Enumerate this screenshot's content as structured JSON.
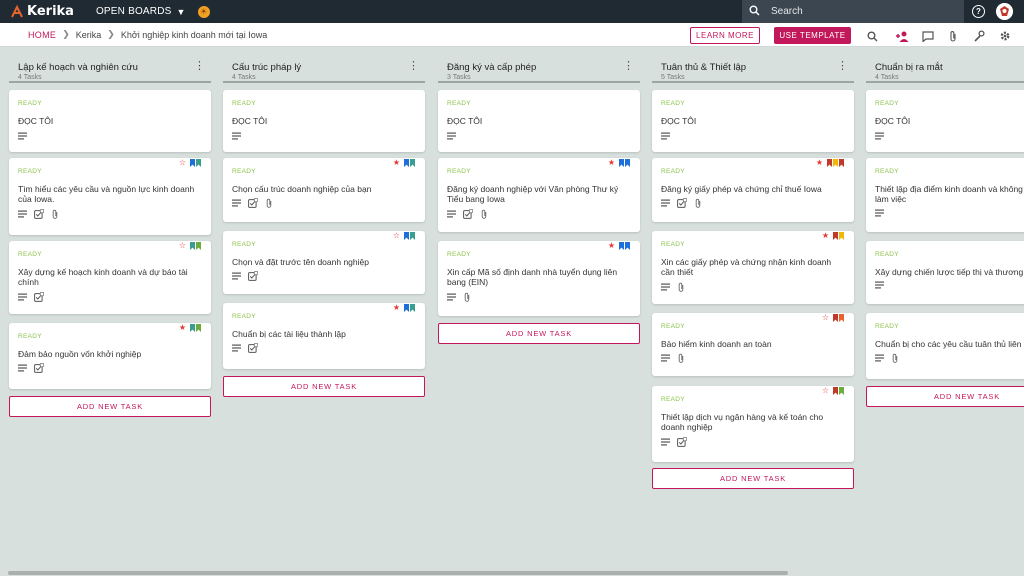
{
  "topbar": {
    "logo": "Kerika",
    "boards_menu": "OPEN BOARDS",
    "search_placeholder": "Search"
  },
  "breadcrumb": {
    "home": "HOME",
    "org": "Kerika",
    "board": "Khởi nghiệp kinh doanh mới tại Iowa"
  },
  "actions": {
    "learn_more": "LEARN MORE",
    "use_template": "USE TEMPLATE"
  },
  "add_task_label": "ADD NEW TASK",
  "colors": {
    "accent": "#c2185b",
    "ready": "#8bc34a",
    "topbar": "#1f2a33",
    "flag_blue": "#1e6fd9",
    "flag_teal": "#3a9e8f",
    "flag_green": "#6cab3c",
    "flag_red": "#c0392b",
    "flag_yellow": "#f2b705",
    "flag_orange": "#e8632b"
  },
  "columns": [
    {
      "title": "Lập kế hoạch và nghiên cứu",
      "count": "4 Tasks",
      "cards": [
        {
          "status": "READY",
          "title": "ĐỌC TÔI",
          "icons": [
            "desc"
          ]
        },
        {
          "status": "READY",
          "title": "Tìm hiểu các yêu cầu và nguồn lực kinh doanh của Iowa.",
          "star": "outline",
          "flags": [
            "flag_blue",
            "flag_teal"
          ],
          "icons": [
            "desc",
            "check",
            "clip"
          ],
          "check_count": "0"
        },
        {
          "status": "READY",
          "title": "Xây dựng kế hoạch kinh doanh và dự báo tài chính",
          "star": "outline",
          "flags": [
            "flag_teal",
            "flag_green"
          ],
          "icons": [
            "desc",
            "check"
          ],
          "check_count": "0"
        },
        {
          "status": "READY",
          "title": "Đảm bảo nguồn vốn khởi nghiệp",
          "star": "filled",
          "flags": [
            "flag_teal",
            "flag_green"
          ],
          "icons": [
            "desc",
            "check"
          ],
          "check_count": "0"
        }
      ]
    },
    {
      "title": "Cấu trúc pháp lý",
      "count": "4 Tasks",
      "cards": [
        {
          "status": "READY",
          "title": "ĐỌC TÔI",
          "icons": [
            "desc"
          ]
        },
        {
          "status": "READY",
          "title": "Chọn cấu trúc doanh nghiệp của bạn",
          "star": "filled",
          "flags": [
            "flag_blue",
            "flag_teal"
          ],
          "icons": [
            "desc",
            "check",
            "clip"
          ],
          "check_count": "0"
        },
        {
          "status": "READY",
          "title": "Chọn và đặt trước tên doanh nghiệp",
          "star": "outline",
          "flags": [
            "flag_blue",
            "flag_teal"
          ],
          "icons": [
            "desc",
            "check"
          ],
          "check_count": "0"
        },
        {
          "status": "READY",
          "title": "Chuẩn bị các tài liệu thành lập",
          "star": "filled",
          "flags": [
            "flag_blue",
            "flag_teal"
          ],
          "icons": [
            "desc",
            "check"
          ],
          "check_count": "0"
        }
      ]
    },
    {
      "title": "Đăng ký và cấp phép",
      "count": "3 Tasks",
      "cards": [
        {
          "status": "READY",
          "title": "ĐỌC TÔI",
          "icons": [
            "desc"
          ]
        },
        {
          "status": "READY",
          "title": "Đăng ký doanh nghiệp với Văn phòng Thư ký Tiểu bang Iowa",
          "star": "filled",
          "flags": [
            "flag_blue",
            "flag_blue"
          ],
          "icons": [
            "desc",
            "check",
            "clip"
          ],
          "check_count": "0"
        },
        {
          "status": "READY",
          "title": "Xin cấp Mã số định danh nhà tuyển dụng liên bang (EIN)",
          "star": "filled",
          "flags": [
            "flag_blue",
            "flag_blue"
          ],
          "icons": [
            "desc",
            "clip"
          ]
        }
      ]
    },
    {
      "title": "Tuân thủ & Thiết lập",
      "count": "5 Tasks",
      "cards": [
        {
          "status": "READY",
          "title": "ĐỌC TÔI",
          "icons": [
            "desc"
          ]
        },
        {
          "status": "READY",
          "title": "Đăng ký giấy phép và chứng chỉ thuế Iowa",
          "star": "filled",
          "flags": [
            "flag_red",
            "flag_yellow",
            "flag_red"
          ],
          "icons": [
            "desc",
            "check",
            "clip"
          ],
          "check_count": "0"
        },
        {
          "status": "READY",
          "title": "Xin các giấy phép và chứng nhận kinh doanh cần thiết",
          "star": "filled",
          "flags": [
            "flag_red",
            "flag_yellow"
          ],
          "icons": [
            "desc",
            "clip"
          ]
        },
        {
          "status": "READY",
          "title": "Bảo hiểm kinh doanh an toàn",
          "star": "outline",
          "flags": [
            "flag_red",
            "flag_orange"
          ],
          "icons": [
            "desc",
            "clip"
          ]
        },
        {
          "status": "READY",
          "title": "Thiết lập dịch vụ ngân hàng và kế toán cho doanh nghiệp",
          "star": "outline",
          "flags": [
            "flag_red",
            "flag_green"
          ],
          "icons": [
            "desc",
            "check"
          ],
          "check_count": "0"
        }
      ]
    },
    {
      "title": "Chuẩn bị ra mắt",
      "count": "4 Tasks",
      "cards": [
        {
          "status": "READY",
          "title": "ĐỌC TÔI",
          "icons": [
            "desc"
          ]
        },
        {
          "status": "READY",
          "title": "Thiết lập địa điểm kinh doanh và không gian làm việc",
          "icons": [
            "desc"
          ]
        },
        {
          "status": "READY",
          "title": "Xây dựng chiến lược tiếp thị và thương hiệu",
          "icons": [
            "desc"
          ]
        },
        {
          "status": "READY",
          "title": "Chuẩn bị cho các yêu cầu tuân thủ liên tục",
          "icons": [
            "desc",
            "clip"
          ]
        }
      ]
    }
  ]
}
